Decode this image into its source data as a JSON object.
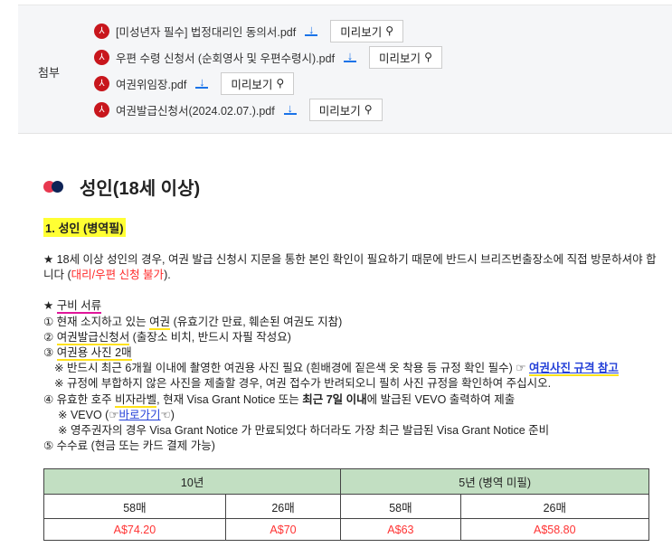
{
  "attachments": {
    "label": "첨부",
    "preview_label": "미리보기",
    "files": [
      {
        "name": "[미성년자 필수] 법정대리인 동의서.pdf"
      },
      {
        "name": "우편 수령 신청서 (순회영사 및 우편수령시).pdf"
      },
      {
        "name": "여권위임장.pdf"
      },
      {
        "name": "여권발급신청서(2024.02.07.).pdf"
      }
    ]
  },
  "section": {
    "title": "성인(18세 이상)",
    "dot_colors": [
      "#e8384f",
      "#0e2356"
    ],
    "subtitle": "1. 성인 (병역필)"
  },
  "intro": {
    "text": "★ 18세 이상 성인의 경우, 여권 발급 신청시 지문을 통한 본인 확인이 필요하기 때문에 반드시 브리즈번출장소에 직접 방문하셔야 합니다 (",
    "red": "대리/우편 신청 불가",
    "end": ")."
  },
  "docs": {
    "heading_star": "★ ",
    "heading": "구비 서류",
    "i1a": "① 현재 소지하고 있는 ",
    "i1b": "여권",
    "i1c": " (유효기간 만료, 훼손된 여권도 지참)",
    "i2a": "② ",
    "i2b": "여권발급신청서",
    "i2c": " (출장소 비치, 반드시 자필 작성요)",
    "i3a": "③ ",
    "i3b": "여권용 사진 2매",
    "n3a": "※ 반드시 최근 6개월 이내에 촬영한 여권용 사진 필요 (흰배경에 짙은색 옷 착용 등 규정 확인 필수) ☞ ",
    "n3link": "여권사진 규격 참고",
    "n3b": "※ 규정에 부합하지 않은 사진을 제출할 경우, 여권 접수가 반려되오니 필히 사진 규정을 확인하여 주십시오.",
    "i4a": "④ 유효한 호주 ",
    "i4b": "비자라벨",
    "i4c": ", 현재 Visa Grant Notice 또는 ",
    "i4d": "최근 7일 이내",
    "i4e": "에 발급된 VEVO 출력하여 제출",
    "n4a": "※ VEVO (☞",
    "n4link": "바로가기",
    "n4b": "☜)",
    "n4c": "※ 영주권자의 경우 Visa Grant Notice 가 만료되었다 하더라도 가장 최근 발급된 Visa Grant Notice 준비",
    "i5": "⑤ 수수료 (현금 또는 카드 결제 가능)"
  },
  "fees": {
    "headers": [
      "10년",
      "5년 (병역 미필)"
    ],
    "pages": [
      "58매",
      "26매",
      "58매",
      "26매"
    ],
    "prices": [
      "A$74.20",
      "A$70",
      "A$63",
      "A$58.80"
    ]
  }
}
